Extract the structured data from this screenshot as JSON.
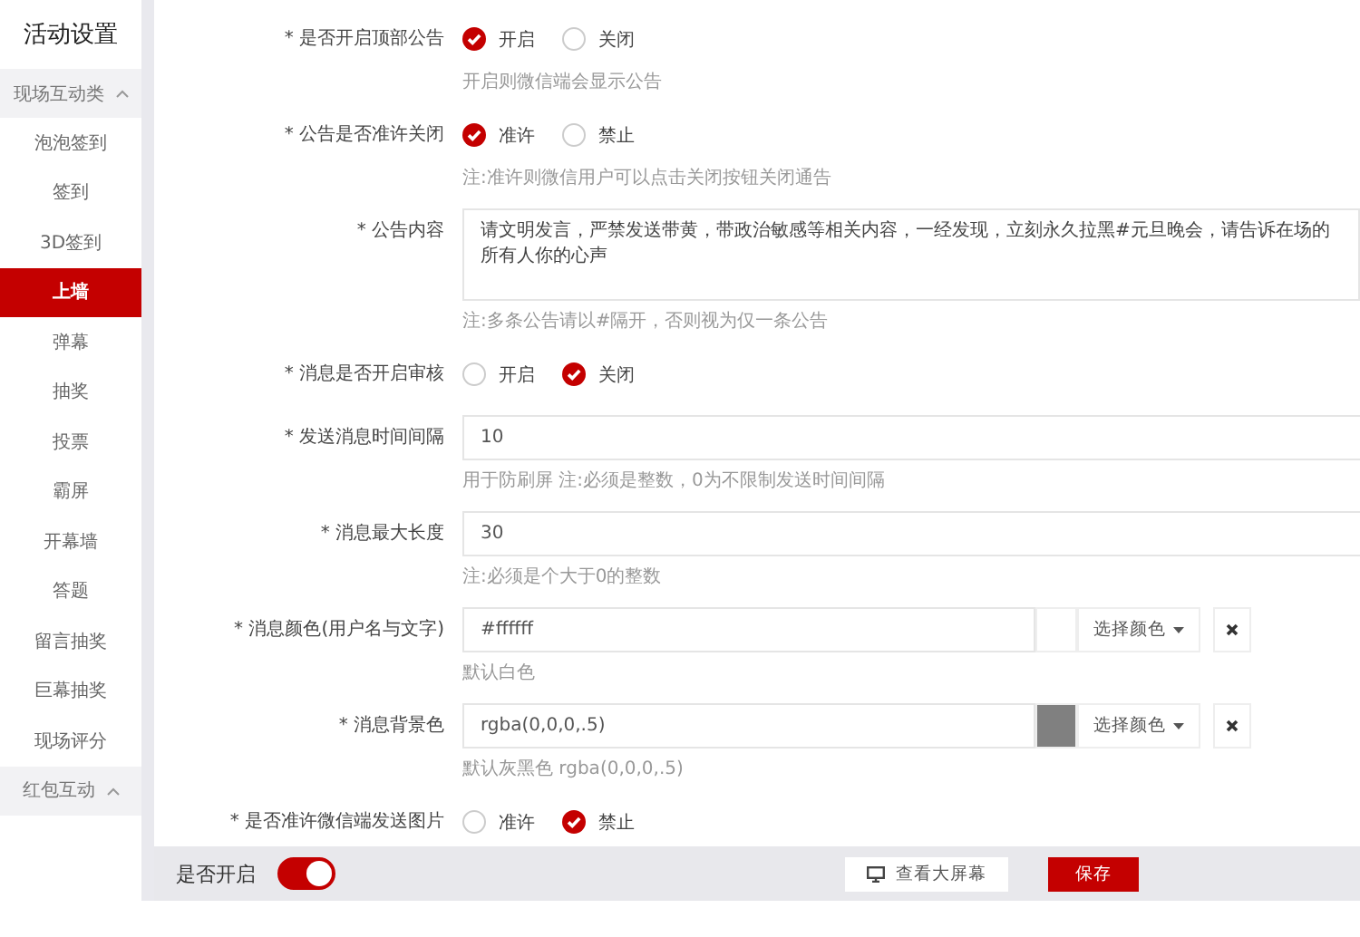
{
  "sidebar": {
    "title": "活动设置",
    "groups": [
      {
        "label": "现场互动类",
        "expanded": true,
        "items": [
          {
            "label": "泡泡签到",
            "selected": false
          },
          {
            "label": "签到",
            "selected": false
          },
          {
            "label": "3D签到",
            "selected": false
          },
          {
            "label": "上墙",
            "selected": true
          },
          {
            "label": "弹幕",
            "selected": false
          },
          {
            "label": "抽奖",
            "selected": false
          },
          {
            "label": "投票",
            "selected": false
          },
          {
            "label": "霸屏",
            "selected": false
          },
          {
            "label": "开幕墙",
            "selected": false
          },
          {
            "label": "答题",
            "selected": false
          },
          {
            "label": "留言抽奖",
            "selected": false
          },
          {
            "label": "巨幕抽奖",
            "selected": false
          },
          {
            "label": "现场评分",
            "selected": false
          }
        ]
      },
      {
        "label": "红包互动",
        "expanded": true
      }
    ]
  },
  "form": {
    "fields": [
      {
        "kind": "radio",
        "label": "* 是否开启顶部公告",
        "options": [
          {
            "label": "开启",
            "selected": true
          },
          {
            "label": "关闭",
            "selected": false
          }
        ],
        "help": "开启则微信端会显示公告"
      },
      {
        "kind": "radio",
        "label": "* 公告是否准许关闭",
        "options": [
          {
            "label": "准许",
            "selected": true
          },
          {
            "label": "禁止",
            "selected": false
          }
        ],
        "help": "注:准许则微信用户可以点击关闭按钮关闭通告"
      },
      {
        "kind": "textarea",
        "label": "* 公告内容",
        "value": "请文明发言，严禁发送带黄，带政治敏感等相关内容，一经发现，立刻永久拉黑#元旦晚会，请告诉在场的所有人你的心声",
        "help": "注:多条公告请以#隔开，否则视为仅一条公告"
      },
      {
        "kind": "radio",
        "label": "* 消息是否开启审核",
        "options": [
          {
            "label": "开启",
            "selected": false
          },
          {
            "label": "关闭",
            "selected": true
          }
        ]
      },
      {
        "kind": "input",
        "label": "* 发送消息时间间隔",
        "value": "10",
        "help": "用于防刷屏 注:必须是整数，0为不限制发送时间间隔"
      },
      {
        "kind": "input",
        "label": "* 消息最大长度",
        "value": "30",
        "help": "注:必须是个大于0的整数"
      },
      {
        "kind": "color",
        "label": "* 消息颜色(用户名与文字)",
        "value": "#ffffff",
        "color": "#ffffff",
        "button": "选择颜色",
        "help": "默认白色"
      },
      {
        "kind": "color",
        "label": "* 消息背景色",
        "value": "rgba(0,0,0,.5)",
        "color": "#808080",
        "button": "选择颜色",
        "help": "默认灰黑色 rgba(0,0,0,.5)"
      },
      {
        "kind": "radio",
        "label": "* 是否准许微信端发送图片",
        "options": [
          {
            "label": "准许",
            "selected": false
          },
          {
            "label": "禁止",
            "selected": true
          }
        ]
      }
    ]
  },
  "footer": {
    "label": "是否开启",
    "toggle": {
      "on": true
    },
    "buttons": [
      {
        "kind": "secondary",
        "label": "查看大屏幕"
      },
      {
        "kind": "primary",
        "label": "保存"
      }
    ]
  }
}
